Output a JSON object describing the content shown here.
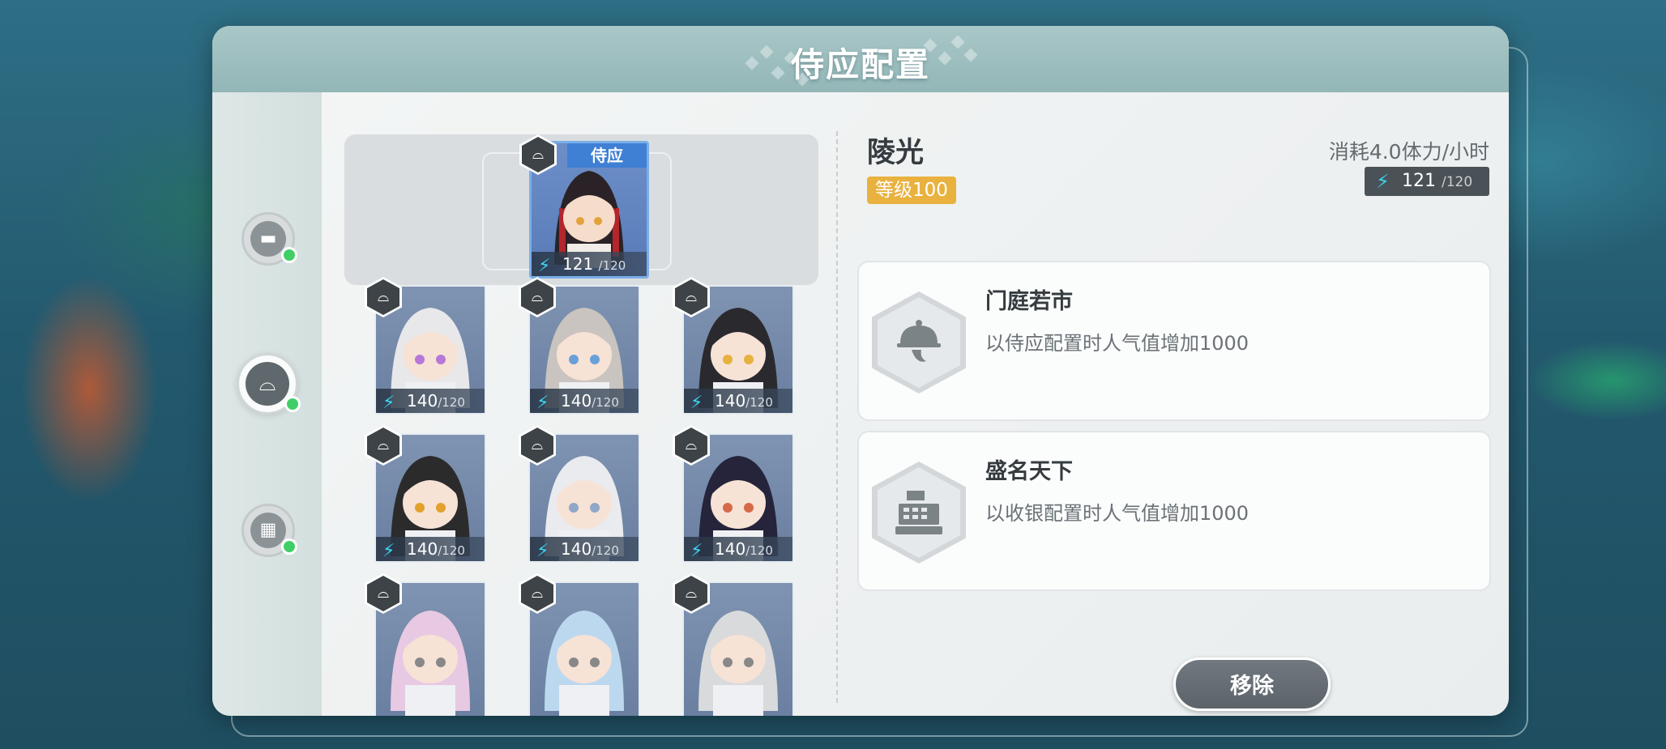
{
  "dialog": {
    "title": "侍应配置"
  },
  "sidebar": {
    "categories": [
      {
        "name": "decor",
        "icon": "sofa-icon",
        "active": false
      },
      {
        "name": "waiter",
        "icon": "serving-cloche-icon",
        "active": true
      },
      {
        "name": "cashier",
        "icon": "cash-register-icon",
        "active": false
      }
    ]
  },
  "slot": {
    "badge": "侍应",
    "stamina_value": "121",
    "stamina_max": "/120"
  },
  "roster": [
    {
      "stamina_value": "140",
      "stamina_max": "/120",
      "hair": "#e8e8ea",
      "eyes": "#b678d8"
    },
    {
      "stamina_value": "140",
      "stamina_max": "/120",
      "hair": "#c9c4bf",
      "eyes": "#6aa0d8"
    },
    {
      "stamina_value": "140",
      "stamina_max": "/120",
      "hair": "#2a2a2e",
      "eyes": "#e6b23c"
    },
    {
      "stamina_value": "140",
      "stamina_max": "/120",
      "hair": "#2c2b2c",
      "eyes": "#e3a12c"
    },
    {
      "stamina_value": "140",
      "stamina_max": "/120",
      "hair": "#e9ebef",
      "eyes": "#8fa7c9"
    },
    {
      "stamina_value": "140",
      "stamina_max": "/120",
      "hair": "#25243a",
      "eyes": "#d46a48"
    },
    {
      "hair": "#e8c9e3"
    },
    {
      "hair": "#bcd8ee"
    },
    {
      "hair": "#d9dadc"
    }
  ],
  "detail": {
    "name": "陵光",
    "level": "等级100",
    "consumption": "消耗4.0体力/小时",
    "stamina_value": "121",
    "stamina_max": "/120"
  },
  "skills": [
    {
      "name": "门庭若市",
      "desc": "以侍应配置时人气值增加1000",
      "icon": "serving-cloche-icon"
    },
    {
      "name": "盛名天下",
      "desc": "以收银配置时人气值增加1000",
      "icon": "cash-register-icon"
    }
  ],
  "actions": {
    "remove_label": "移除"
  },
  "colors": {
    "accent": "#e9b23f",
    "stamina": "#38d6f0",
    "active_dot": "#3fcf66",
    "slot_badge": "#3f7fd4"
  }
}
